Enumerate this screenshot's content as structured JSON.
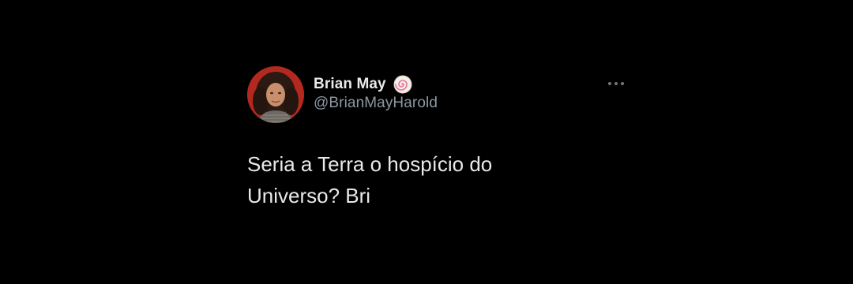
{
  "tweet": {
    "author": {
      "display_name": "Brian May",
      "handle": "@BrianMayHarold",
      "avatar_icon": "profile-photo",
      "badge_icon": "swirl-badge-icon"
    },
    "text": "Seria a Terra o hospício do\nUniverso? Bri",
    "more_icon": "more-horizontal-icon"
  },
  "colors": {
    "background": "#000000",
    "primary_text": "#e7e9ea",
    "secondary_text": "#8b98a5",
    "avatar_background": "#b3281f"
  }
}
